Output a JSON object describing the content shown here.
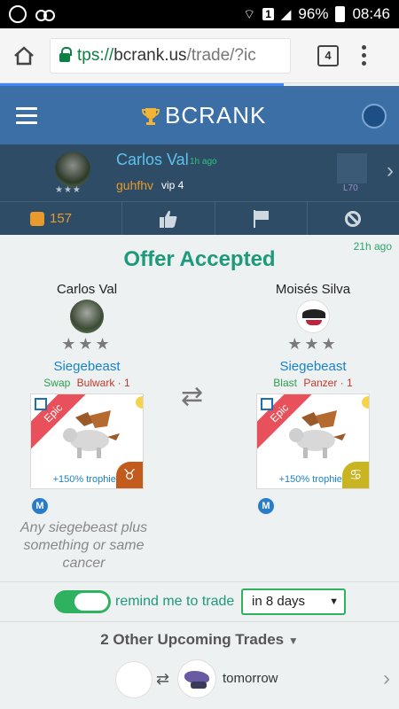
{
  "status_bar": {
    "battery": "96%",
    "time": "08:46",
    "sim": "1"
  },
  "browser": {
    "url_scheme": "tps://",
    "url_domain": "bcrank.us",
    "url_path": "/trade/?ic",
    "tab_count": "4"
  },
  "app": {
    "brand": "BCRANK"
  },
  "profile": {
    "name": "Carlos Val",
    "time_ago": "1h ago",
    "guild": "guhfhv",
    "vip": "vip 4",
    "level": "L70"
  },
  "actions": {
    "likes": "157"
  },
  "offer": {
    "time_ago": "21h ago",
    "title": "Offer Accepted",
    "left": {
      "trader": "Carlos Val",
      "monster": "Siegebeast",
      "tag1": "Swap",
      "tag2": "Bulwark · 1",
      "ribbon": "Epic",
      "trophies": "+150% trophies",
      "zodiac": "♉",
      "badge": "M",
      "wish": "Any siegebeast plus something or same cancer"
    },
    "right": {
      "trader": "Moisés Silva",
      "monster": "Siegebeast",
      "tag1": "Blast",
      "tag2": "Panzer · 1",
      "ribbon": "Epic",
      "trophies": "+150% trophies",
      "zodiac": "♋",
      "badge": "M"
    }
  },
  "reminder": {
    "label": "remind me to trade",
    "selected": "in 8 days"
  },
  "upcoming": {
    "heading": "2 Other Upcoming Trades",
    "when": "tomorrow"
  },
  "colors": {
    "header": "#3b6fa6",
    "profile_bg": "#2f4c66",
    "accent_green": "#1d9a7a",
    "toggle": "#2eb25f",
    "link_blue": "#1a83c6",
    "epic": "#e8505b"
  }
}
